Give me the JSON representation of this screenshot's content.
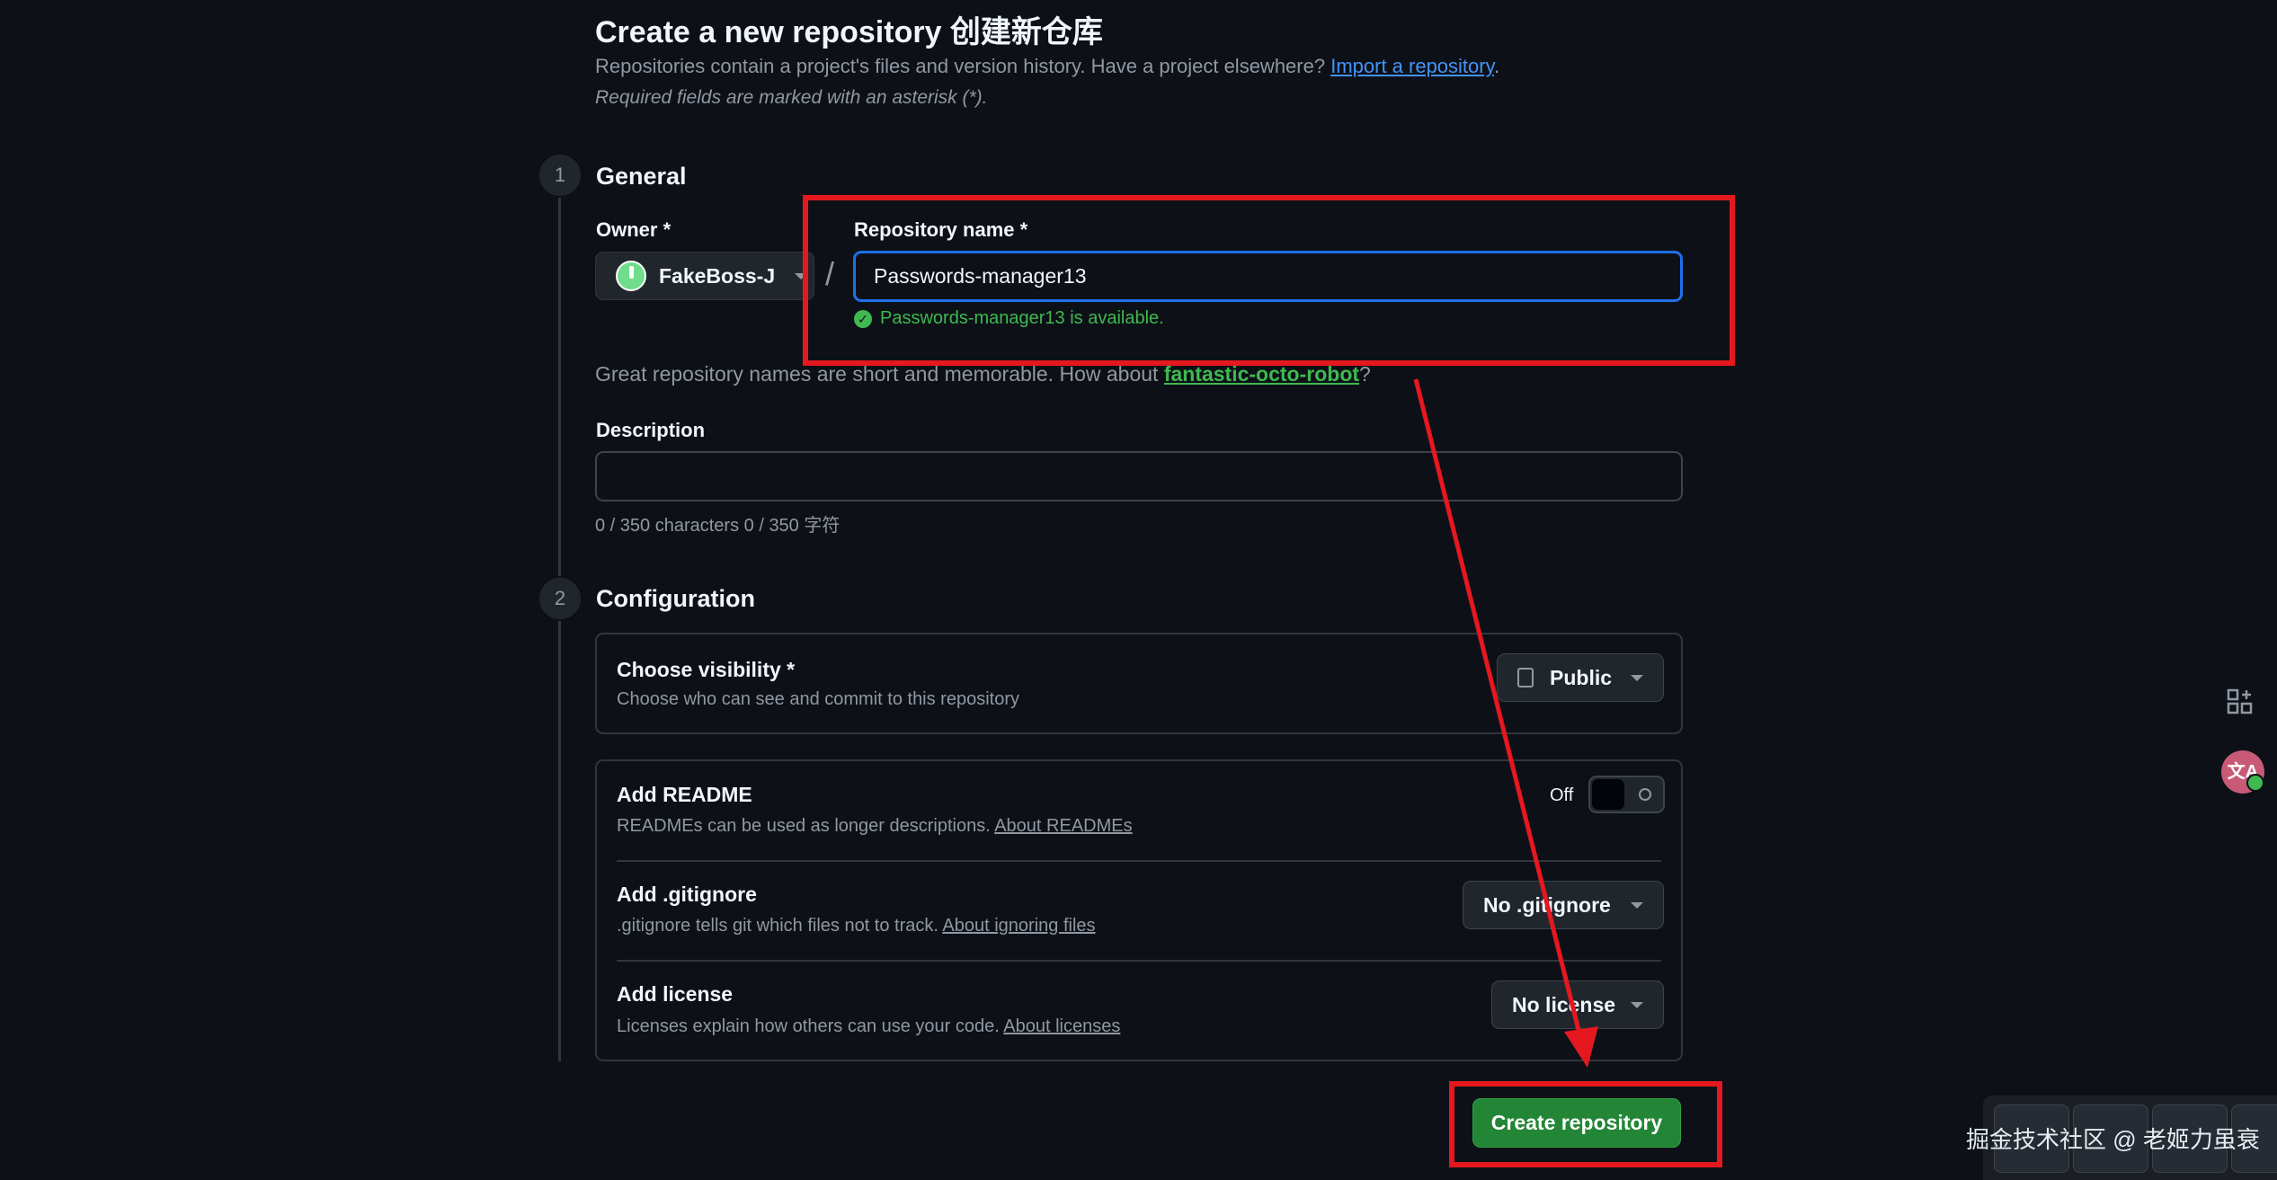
{
  "header": {
    "title": "Create a new repository  创建新仓库",
    "subtitle_prefix": "Repositories contain a project's files and version history. Have a project elsewhere? ",
    "import_link": "Import a repository",
    "subtitle_suffix": ".",
    "required_note": "Required fields are marked with an asterisk (*)."
  },
  "general": {
    "step": "1",
    "title": "General",
    "owner_label": "Owner *",
    "owner_value": "FakeBoss-J",
    "separator": "/",
    "repo_name_label": "Repository name *",
    "repo_name_value": "Passwords-manager13",
    "availability": "Passwords-manager13 is available.",
    "suggestion_prefix": "Great repository names are short and memorable. How about ",
    "suggestion_name": "fantastic-octo-robot",
    "suggestion_suffix": "?",
    "description_label": "Description",
    "description_value": "",
    "char_count": "0 / 350 characters  0 / 350 字符"
  },
  "configuration": {
    "step": "2",
    "title": "Configuration",
    "visibility": {
      "title": "Choose visibility *",
      "desc": "Choose who can see and commit to this repository",
      "value": "Public"
    },
    "readme": {
      "title": "Add README",
      "desc": "READMEs can be used as longer descriptions. ",
      "link": "About READMEs",
      "toggle_label": "Off",
      "toggle_on": false
    },
    "gitignore": {
      "title": "Add .gitignore",
      "desc": ".gitignore tells git which files not to track. ",
      "link": "About ignoring files",
      "value": "No .gitignore"
    },
    "license": {
      "title": "Add license",
      "desc": "Licenses explain how others can use your code. ",
      "link": "About licenses",
      "value": "No license"
    }
  },
  "create_button": "Create repository",
  "side_icons": [
    "apps-add-icon",
    "translate-icon"
  ],
  "watermark": "掘金技术社区 @ 老姬力虽衰",
  "colors": {
    "background": "#0d1117",
    "accent_blue": "#1f6feb",
    "success_green": "#3fb950",
    "button_green": "#238636",
    "annotation_red": "#e5181f"
  }
}
